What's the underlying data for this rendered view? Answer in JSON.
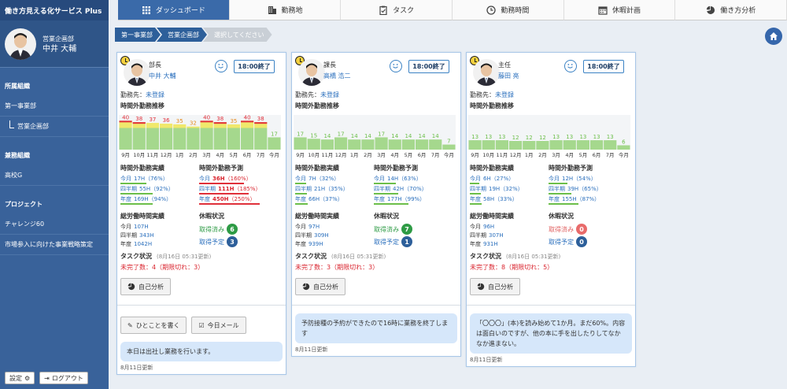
{
  "app": {
    "title": "働き方見える化サービス Plus"
  },
  "user": {
    "dept": "営業企画部",
    "name": "中井 大輔"
  },
  "sidebar": {
    "sections": [
      {
        "title": "所属組織",
        "items": [
          {
            "label": "第一事業部",
            "sub": false
          },
          {
            "label": "営業企画部",
            "sub": true
          }
        ]
      },
      {
        "title": "兼務組織",
        "items": [
          {
            "label": "高校G",
            "sub": false
          }
        ]
      },
      {
        "title": "プロジェクト",
        "items": [
          {
            "label": "チャレンジ60",
            "sub": false
          },
          {
            "label": "市場参入に向けた事業戦略策定",
            "sub": false
          }
        ]
      }
    ],
    "settings_label": "設定",
    "logout_label": "ログアウト"
  },
  "tabs": [
    {
      "label": "ダッシュボード",
      "icon": "grid-icon",
      "active": true
    },
    {
      "label": "勤務地",
      "icon": "building-icon",
      "active": false
    },
    {
      "label": "タスク",
      "icon": "clipboard-check-icon",
      "active": false
    },
    {
      "label": "勤務時間",
      "icon": "clock-icon",
      "active": false
    },
    {
      "label": "休暇計画",
      "icon": "calendar-icon",
      "active": false
    },
    {
      "label": "働き方分析",
      "icon": "pie-icon",
      "active": false
    }
  ],
  "breadcrumb": {
    "items": [
      "第一事業部",
      "営業企画部"
    ],
    "placeholder": "選択してください"
  },
  "labels": {
    "workplace": "勤務先：",
    "overtime_trend": "時間外勤務推移",
    "overtime_actual": "時間外勤務実績",
    "overtime_forecast": "時間外勤務予測",
    "total_actual": "総労働時間実績",
    "vacation": "休暇状況",
    "task_status": "タスク状況",
    "analysis_button": "自己分析",
    "post_button": "ひとことを書く",
    "mail_button": "今日メール",
    "end_time_button": "18:00終了",
    "months": [
      "9月",
      "10月",
      "11月",
      "12月",
      "1月",
      "2月",
      "3月",
      "4月",
      "5月",
      "6月",
      "7月",
      "今月"
    ]
  },
  "colors": {
    "primary": "#3a6aa9",
    "bar_green": "#a5d88d",
    "bar_yellow": "#f0e86c",
    "line_red": "#e0303a",
    "red_text": "#d9232d",
    "badge_green": "#2e9b45",
    "badge_blue": "#2d5f9a",
    "badge_red": "#e86b6b"
  },
  "cards": [
    {
      "role": "部長",
      "name": "中井 大輔",
      "workplace": "未登録",
      "is_self": true,
      "chart_data": {
        "type": "bar",
        "categories": [
          "9月",
          "10月",
          "11月",
          "12月",
          "1月",
          "2月",
          "3月",
          "4月",
          "5月",
          "6月",
          "7月",
          "今月"
        ],
        "values": [
          40,
          38,
          37,
          36,
          35,
          32,
          40,
          38,
          35,
          40,
          38,
          17
        ],
        "label_colors": [
          "red",
          "red",
          "red",
          "red",
          "orange",
          "orange",
          "red",
          "red",
          "orange",
          "red",
          "red",
          "green"
        ]
      },
      "actual": [
        {
          "label": "今月",
          "value": "17H",
          "pct": "（76%）",
          "fill": 0.76
        },
        {
          "label": "四半期",
          "value": "55H",
          "pct": "（92%）",
          "fill": 0.92
        },
        {
          "label": "年度",
          "value": "169H",
          "pct": "（94%）",
          "fill": 0.94
        }
      ],
      "forecast": [
        {
          "label": "今月",
          "value": "36H",
          "pct": "（160%）",
          "fill": 1.6,
          "red": true
        },
        {
          "label": "四半期",
          "value": "111H",
          "pct": "（185%）",
          "fill": 1.85,
          "red": true
        },
        {
          "label": "年度",
          "value": "450H",
          "pct": "（250%）",
          "fill": 2.5,
          "red": true
        }
      ],
      "total": [
        {
          "label": "今月",
          "value": "107H"
        },
        {
          "label": "四半期",
          "value": "343H"
        },
        {
          "label": "年度",
          "value": "1042H"
        }
      ],
      "vacation": [
        {
          "label": "取得済み",
          "count": "6",
          "color": "green"
        },
        {
          "label": "取得予定",
          "count": "3",
          "color": "blue"
        }
      ],
      "task_updated": "(8月16日 05:31更新)",
      "task_text": "未完了数：4（期限切れ：3）",
      "message": "本日は出社し業務を行います。",
      "message_date": "8月11日更新"
    },
    {
      "role": "課長",
      "name": "高橋 浩二",
      "workplace": "未登録",
      "is_self": false,
      "chart_data": {
        "type": "bar",
        "categories": [
          "9月",
          "10月",
          "11月",
          "12月",
          "1月",
          "2月",
          "3月",
          "4月",
          "5月",
          "6月",
          "7月",
          "今月"
        ],
        "values": [
          17,
          15,
          14,
          17,
          14,
          14,
          17,
          14,
          14,
          14,
          14,
          7
        ],
        "label_colors": [
          "green",
          "green",
          "green",
          "green",
          "green",
          "green",
          "green",
          "green",
          "green",
          "green",
          "green",
          "green"
        ]
      },
      "actual": [
        {
          "label": "今月",
          "value": "7H",
          "pct": "（32%）",
          "fill": 0.32
        },
        {
          "label": "四半期",
          "value": "21H",
          "pct": "（35%）",
          "fill": 0.35
        },
        {
          "label": "年度",
          "value": "66H",
          "pct": "（37%）",
          "fill": 0.37
        }
      ],
      "forecast": [
        {
          "label": "今月",
          "value": "14H",
          "pct": "（63%）",
          "fill": 0.63,
          "red": false
        },
        {
          "label": "四半期",
          "value": "42H",
          "pct": "（70%）",
          "fill": 0.7,
          "red": false
        },
        {
          "label": "年度",
          "value": "177H",
          "pct": "（99%）",
          "fill": 0.99,
          "red": false
        }
      ],
      "total": [
        {
          "label": "今月",
          "value": "97H"
        },
        {
          "label": "四半期",
          "value": "309H"
        },
        {
          "label": "年度",
          "value": "939H"
        }
      ],
      "vacation": [
        {
          "label": "取得済み",
          "count": "7",
          "color": "green"
        },
        {
          "label": "取得予定",
          "count": "1",
          "color": "blue"
        }
      ],
      "task_updated": "(8月16日 05:31更新)",
      "task_text": "未完了数：3（期限切れ：3）",
      "message": "予防接種の予約ができたので16時に業務を終了します",
      "message_date": "8月11日更新"
    },
    {
      "role": "主任",
      "name": "藤田 亮",
      "workplace": "未登録",
      "is_self": false,
      "chart_data": {
        "type": "bar",
        "categories": [
          "9月",
          "10月",
          "11月",
          "12月",
          "1月",
          "2月",
          "3月",
          "4月",
          "5月",
          "6月",
          "7月",
          "今月"
        ],
        "values": [
          13,
          13,
          13,
          12,
          12,
          12,
          13,
          13,
          13,
          13,
          13,
          6
        ],
        "label_colors": [
          "green",
          "green",
          "green",
          "green",
          "green",
          "green",
          "green",
          "green",
          "green",
          "green",
          "green",
          "green"
        ]
      },
      "actual": [
        {
          "label": "今月",
          "value": "6H",
          "pct": "（27%）",
          "fill": 0.27
        },
        {
          "label": "四半期",
          "value": "19H",
          "pct": "（32%）",
          "fill": 0.32
        },
        {
          "label": "年度",
          "value": "58H",
          "pct": "（33%）",
          "fill": 0.33
        }
      ],
      "forecast": [
        {
          "label": "今月",
          "value": "12H",
          "pct": "（54%）",
          "fill": 0.54,
          "red": false
        },
        {
          "label": "四半期",
          "value": "39H",
          "pct": "（65%）",
          "fill": 0.65,
          "red": false
        },
        {
          "label": "年度",
          "value": "155H",
          "pct": "（87%）",
          "fill": 0.87,
          "red": false
        }
      ],
      "total": [
        {
          "label": "今月",
          "value": "96H"
        },
        {
          "label": "四半期",
          "value": "307H"
        },
        {
          "label": "年度",
          "value": "931H"
        }
      ],
      "vacation": [
        {
          "label": "取得済み",
          "count": "0",
          "color": "red"
        },
        {
          "label": "取得予定",
          "count": "0",
          "color": "blue"
        }
      ],
      "task_updated": "(8月16日 05:31更新)",
      "task_text": "未完了数：8（期限切れ：5）",
      "message": "「〇〇〇」(本)を読み始めて1か月。まだ60%。内容は面白いのですが、他の本に手を出したりしてなかなか進まない。",
      "message_date": "8月11日更新"
    }
  ]
}
